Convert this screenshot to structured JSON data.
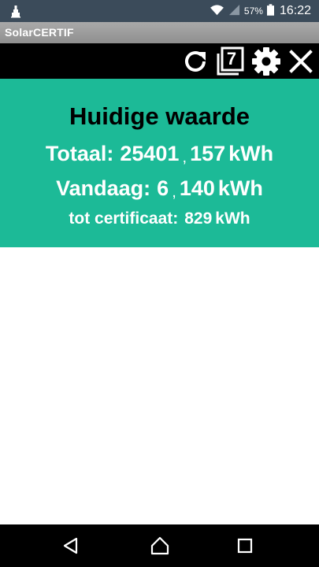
{
  "status_bar": {
    "battery_percent": "57%",
    "time": "16:22",
    "icons": [
      "notification-icon",
      "wifi-icon",
      "signal-icon",
      "battery-icon"
    ]
  },
  "app": {
    "title": "SolarCERTIF"
  },
  "toolbar": {
    "icons": [
      "refresh-icon",
      "pages-icon",
      "settings-icon",
      "close-icon"
    ],
    "pages_count": "7"
  },
  "panel": {
    "heading": "Huidige waarde",
    "total": {
      "label": "Totaal:",
      "integer": "25401",
      "separator": ",",
      "decimal": "157",
      "unit": "kWh"
    },
    "today": {
      "label": "Vandaag:",
      "integer": "6",
      "separator": ",",
      "decimal": "140",
      "unit": "kWh"
    },
    "certificate": {
      "label": "tot certificaat:",
      "value": "829",
      "unit": "kWh"
    },
    "background_color": "#1cba97"
  },
  "nav_bar": {
    "icons": [
      "back-icon",
      "home-icon",
      "recent-apps-icon"
    ]
  }
}
